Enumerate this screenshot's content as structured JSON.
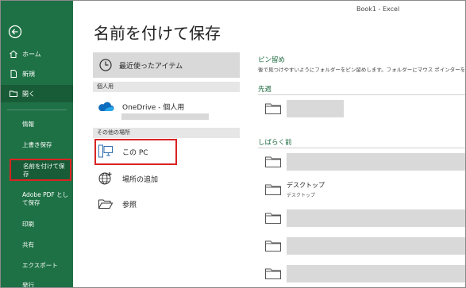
{
  "window": {
    "title": "Book1 - Excel"
  },
  "page_title": "名前を付けて保存",
  "rail": {
    "home": "ホーム",
    "new": "新規",
    "open": "開く",
    "info": "情報",
    "overwrite": "上書き保存",
    "saveas_line1": "名前を付けて保",
    "saveas_line2": "存",
    "adobe_line1": "Adobe PDF とし",
    "adobe_line2": "て保存",
    "print": "印刷",
    "share": "共有",
    "export": "エクスポート",
    "publish": "発行"
  },
  "locations": {
    "recent": "最近使ったアイテム",
    "personal_header": "個人用",
    "onedrive": "OneDrive - 個人用",
    "other_header": "その他の場所",
    "this_pc": "この PC",
    "add_place": "場所の追加",
    "browse": "参照"
  },
  "right": {
    "pinned_header": "ピン留め",
    "pinned_desc": "後で見つけやすいようにフォルダーをピン留めします。フォルダーにマウス ポインターを移動したと",
    "last_week": "先週",
    "older": "しばらく前",
    "desktop": "デスクトップ",
    "desktop_path": "デスクトップ"
  },
  "colors": {
    "rail": "#1e7145",
    "highlight": "#d92323",
    "selected_loc": "#d9d9d9"
  }
}
